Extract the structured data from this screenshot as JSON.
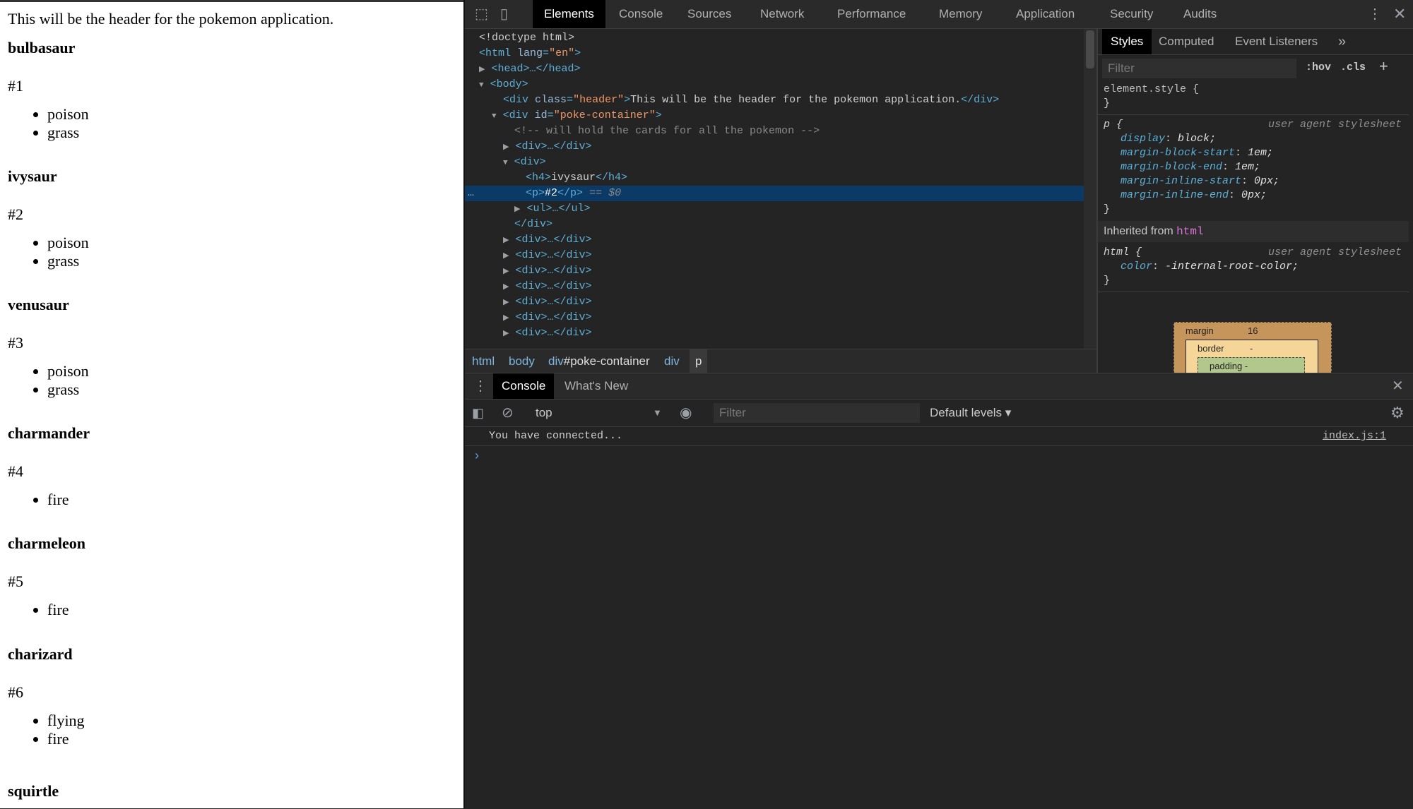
{
  "page": {
    "header": "This will be the header for the pokemon application.",
    "pokemon": [
      {
        "name": "bulbasaur",
        "number": "#1",
        "types": [
          "poison",
          "grass"
        ]
      },
      {
        "name": "ivysaur",
        "number": "#2",
        "types": [
          "poison",
          "grass"
        ]
      },
      {
        "name": "venusaur",
        "number": "#3",
        "types": [
          "poison",
          "grass"
        ]
      },
      {
        "name": "charmander",
        "number": "#4",
        "types": [
          "fire"
        ]
      },
      {
        "name": "charmeleon",
        "number": "#5",
        "types": [
          "fire"
        ]
      },
      {
        "name": "charizard",
        "number": "#6",
        "types": [
          "flying",
          "fire"
        ]
      },
      {
        "name": "squirtle"
      }
    ]
  },
  "devtools": {
    "tabs": [
      "Elements",
      "Console",
      "Sources",
      "Network",
      "Performance",
      "Memory",
      "Application",
      "Security",
      "Audits"
    ],
    "active_tab": "Elements",
    "dom": {
      "doctype": "<!doctype html>",
      "html_open": "<html",
      "lang_attr": "lang",
      "lang_val": "\"en\"",
      "gt": ">",
      "head": "<head>…</head>",
      "body": "<body>",
      "div_open": "<div",
      "class_attr": "class",
      "header_val": "\"header\"",
      "header_text": "This will be the header for the pokemon application.",
      "div_close": "</div>",
      "id_attr": "id",
      "container_val": "\"poke-container\"",
      "comment": "<!-- will hold the cards for all the pokemon -->",
      "collapsed_div": "<div>…</div>",
      "div_tag": "<div>",
      "h4_open": "<h4>",
      "h4_text": "ivysaur",
      "h4_close": "</h4>",
      "p_open": "<p>",
      "p_text": "#2",
      "p_close": "</p>",
      "selected_marker": "== $0",
      "ul": "<ul>…</ul>",
      "dots": "…"
    },
    "breadcrumb": {
      "html": "html",
      "body": "body",
      "div_prefix": "div",
      "container_id": "#poke-container",
      "div": "div",
      "current": "p"
    },
    "styles": {
      "tabs": [
        "Styles",
        "Computed",
        "Event Listeners"
      ],
      "more": "»",
      "filter_placeholder": "Filter",
      "hov": ":hov",
      "cls": ".cls",
      "add": "+",
      "element_style": "element.style {",
      "close_brace": "}",
      "p_selector": "p {",
      "user_agent": "user agent stylesheet",
      "p_rules": [
        {
          "prop": "display",
          "val": "block;"
        },
        {
          "prop": "margin-block-start",
          "val": "1em;"
        },
        {
          "prop": "margin-block-end",
          "val": "1em;"
        },
        {
          "prop": "margin-inline-start",
          "val": "0px;"
        },
        {
          "prop": "margin-inline-end",
          "val": "0px;"
        }
      ],
      "inherited_label": "Inherited from",
      "inherited_from": "html",
      "html_selector": "html {",
      "html_rules": [
        {
          "prop": "color",
          "val": "-internal-root-color;"
        }
      ],
      "box_margin_label": "margin",
      "box_margin_value": "16",
      "box_border_label": "border",
      "box_border_value": "-",
      "box_padding_label": "padding -"
    },
    "console": {
      "tabs": [
        "Console",
        "What's New"
      ],
      "context": "top",
      "filter_placeholder": "Filter",
      "levels": "Default levels ▾",
      "message": "You have connected...",
      "source": "index.js:1",
      "prompt": "›"
    }
  }
}
